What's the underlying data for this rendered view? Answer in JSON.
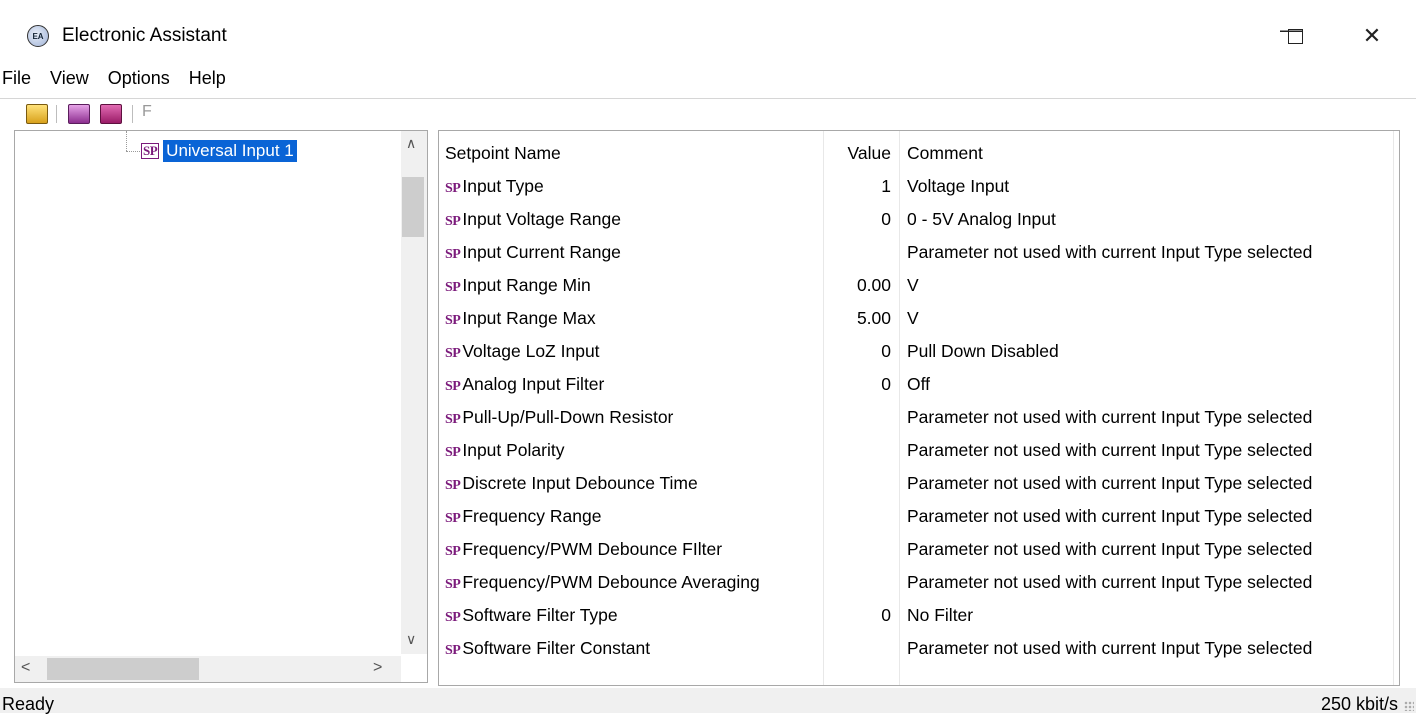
{
  "window": {
    "title": "Electronic Assistant",
    "icon_name": "electronic-assistant-logo-icon",
    "icon_text": "EA",
    "minimize_glyph": "—",
    "close_glyph": "✕"
  },
  "menu": [
    "File",
    "View",
    "Options",
    "Help"
  ],
  "toolbar": {
    "buttons": [
      "can-connect-icon",
      "read-setpoints-icon",
      "write-setpoints-icon"
    ],
    "disabled_label": "F"
  },
  "tree": {
    "selected_node": {
      "icon_text": "SP",
      "label": "Universal Input 1"
    }
  },
  "table": {
    "headers": {
      "name": "Setpoint Name",
      "value": "Value",
      "comment": "Comment"
    },
    "row_icon": "SP",
    "rows": [
      {
        "name": "Input Type",
        "value": "1",
        "comment": "Voltage Input"
      },
      {
        "name": "Input Voltage Range",
        "value": "0",
        "comment": "0 - 5V Analog Input"
      },
      {
        "name": "Input Current Range",
        "value": "",
        "comment": "Parameter not used with current Input Type selected"
      },
      {
        "name": "Input Range Min",
        "value": "0.00",
        "comment": "V"
      },
      {
        "name": "Input Range Max",
        "value": "5.00",
        "comment": "V"
      },
      {
        "name": "Voltage LoZ Input",
        "value": "0",
        "comment": "Pull Down Disabled"
      },
      {
        "name": "Analog Input Filter",
        "value": "0",
        "comment": "Off"
      },
      {
        "name": "Pull-Up/Pull-Down Resistor",
        "value": "",
        "comment": "Parameter not used with current Input Type selected"
      },
      {
        "name": "Input Polarity",
        "value": "",
        "comment": "Parameter not used with current Input Type selected"
      },
      {
        "name": "Discrete Input Debounce Time",
        "value": "",
        "comment": "Parameter not used with current Input Type selected"
      },
      {
        "name": "Frequency Range",
        "value": "",
        "comment": "Parameter not used with current Input Type selected"
      },
      {
        "name": "Frequency/PWM Debounce FIlter",
        "value": "",
        "comment": "Parameter not used with current Input Type selected"
      },
      {
        "name": "Frequency/PWM Debounce Averaging",
        "value": "",
        "comment": "Parameter not used with current Input Type selected"
      },
      {
        "name": "Software Filter Type",
        "value": "0",
        "comment": "No Filter"
      },
      {
        "name": "Software Filter Constant",
        "value": "",
        "comment": "Parameter not used with current Input Type selected"
      }
    ]
  },
  "status": {
    "left": "Ready",
    "right": "250 kbit/s"
  },
  "colors": {
    "selection": "#0a64d6",
    "sp_icon": "#7b1a7b"
  }
}
